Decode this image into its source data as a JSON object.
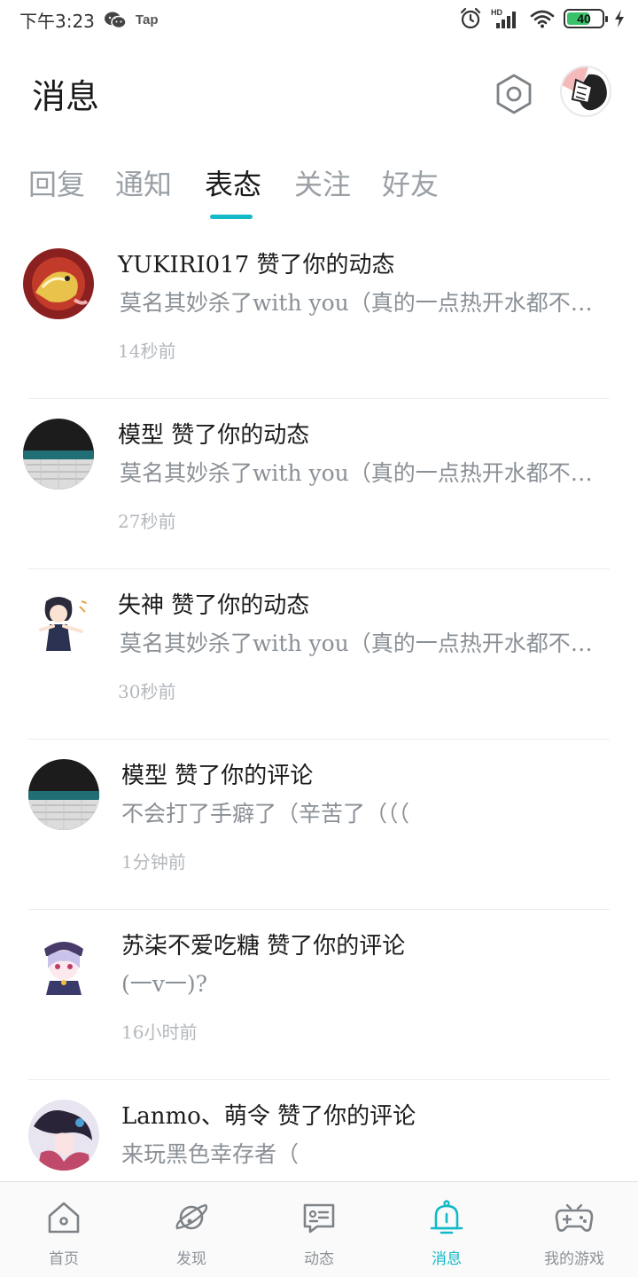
{
  "status_bar": {
    "time": "下午3:23",
    "tap_label": "Tap",
    "network_label": "HD",
    "battery_level": "40"
  },
  "header": {
    "title": "消息"
  },
  "tabs": [
    {
      "label": "回复",
      "active": false
    },
    {
      "label": "通知",
      "active": false
    },
    {
      "label": "表态",
      "active": true
    },
    {
      "label": "关注",
      "active": false
    },
    {
      "label": "好友",
      "active": false
    }
  ],
  "messages": [
    {
      "title": "YUKIRI017 赞了你的动态",
      "body": "莫名其妙杀了with you（真的一点热开水都不想喝",
      "time": "14秒前",
      "avatar": "avatar-dragon"
    },
    {
      "title": "模型 赞了你的动态",
      "body": "莫名其妙杀了with you（真的一点热开水都不想喝",
      "time": "27秒前",
      "avatar": "avatar-keyboard"
    },
    {
      "title": "失神 赞了你的动态",
      "body": "莫名其妙杀了with you（真的一点热开水都不想喝",
      "time": "30秒前",
      "avatar": "avatar-anime-girl"
    },
    {
      "title": "模型 赞了你的评论",
      "body": "不会打了手癖了（辛苦了（（（",
      "time": "1分钟前",
      "avatar": "avatar-keyboard"
    },
    {
      "title": "苏柒不爱吃糖 赞了你的评论",
      "body": "(一v一)?",
      "time": "16小时前",
      "avatar": "avatar-chibi"
    },
    {
      "title": "Lanmo、萌令 赞了你的评论",
      "body": "来玩黑色幸存者（",
      "time": "",
      "avatar": "avatar-dark"
    }
  ],
  "bottom_nav": [
    {
      "label": "首页",
      "icon": "home-icon",
      "active": false
    },
    {
      "label": "发现",
      "icon": "planet-icon",
      "active": false
    },
    {
      "label": "动态",
      "icon": "chat-icon",
      "active": false
    },
    {
      "label": "消息",
      "icon": "bell-icon",
      "active": true
    },
    {
      "label": "我的游戏",
      "icon": "gamepad-icon",
      "active": false
    }
  ],
  "colors": {
    "accent": "#14b9c8",
    "inactive": "#9aa0a6",
    "divider": "#ececec"
  }
}
